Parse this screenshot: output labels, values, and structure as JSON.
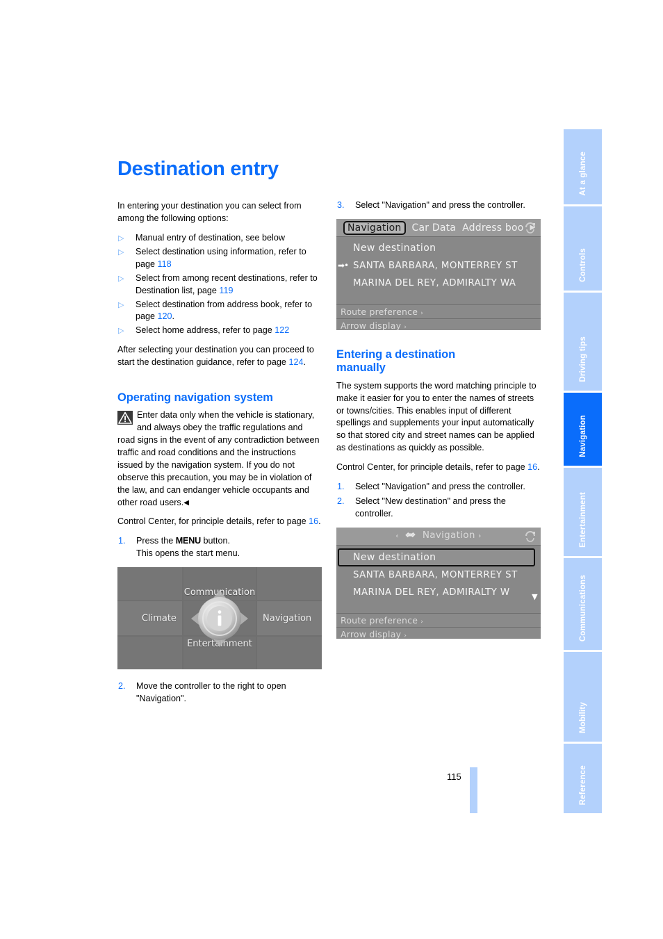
{
  "page": {
    "number": "115",
    "title": "Destination entry"
  },
  "sidebar": {
    "tabs": [
      {
        "label": "At a glance",
        "active": false
      },
      {
        "label": "Controls",
        "active": false
      },
      {
        "label": "Driving tips",
        "active": false
      },
      {
        "label": "Navigation",
        "active": true
      },
      {
        "label": "Entertainment",
        "active": false
      },
      {
        "label": "Communications",
        "active": false
      },
      {
        "label": "Mobility",
        "active": false
      },
      {
        "label": "Reference",
        "active": false
      }
    ],
    "active_color": "#0a6dfb",
    "inactive_color": "#b3d1fc"
  },
  "left_column": {
    "intro": "In entering your destination you can select from among the following options:",
    "options": [
      {
        "text": "Manual entry of destination, see below",
        "page": ""
      },
      {
        "text": "Select destination using information, refer to page ",
        "page": "118",
        "tail": ""
      },
      {
        "text": "Select from among recent destinations, refer to Destination list, page ",
        "page": "119",
        "tail": ""
      },
      {
        "text": "Select destination from address book, refer to page ",
        "page": "120",
        "tail": "."
      },
      {
        "text": "Select home address, refer to page ",
        "page": "122",
        "tail": ""
      }
    ],
    "after_paragraph_pre": "After selecting your destination you can proceed to start the destination guidance, refer to page ",
    "after_paragraph_page": "124",
    "after_paragraph_post": ".",
    "section_title": "Operating navigation system",
    "warning_text": "Enter data only when the vehicle is stationary, and always obey the traffic regulations and road signs in the event of any contradiction between traffic and road conditions and the instructions issued by the navigation system. If you do not observe this precaution, you may be in violation of the law, and can endanger vehicle occupants and other road users.",
    "warning_endmark": "◀",
    "control_center_pre": "Control Center, for principle details, refer to page ",
    "control_center_page": "16",
    "control_center_post": ".",
    "step1_pre": "Press the ",
    "step1_kw": "MENU",
    "step1_post": " button.",
    "step1_line2": "This opens the start menu.",
    "step1_num": "1.",
    "step2_num": "2.",
    "step2_text": "Move the controller to the right to open \"Navigation\"."
  },
  "right_column": {
    "step3_num": "3.",
    "step3_text": "Select \"Navigation\" and press the controller.",
    "section_title_line1": "Entering a destination",
    "section_title_line2": "manually",
    "paragraph": "The system supports the word matching principle to make it easier for you to enter the names of streets or towns/cities. This enables input of different spellings and supplements your input automatically so that stored city and street names can be applied as destinations as quickly as possible.",
    "control_center_pre": "Control Center, for principle details, refer to page ",
    "control_center_page": "16",
    "control_center_post": ".",
    "step1_num": "1.",
    "step1_text": "Select \"Navigation\" and press the controller.",
    "step2_num": "2.",
    "step2_text": "Select \"New destination\" and press the controller."
  },
  "start_menu_screenshot": {
    "name": "idrive-start-menu",
    "communication": "Communication",
    "climate": "Climate",
    "navigation": "Navigation",
    "entertainment": "Entertainment",
    "center_icon": "info-icon"
  },
  "nav_screenshot_1": {
    "name": "idrive-navigation-menu-tabbar",
    "tabs": [
      "Navigation",
      "Car Data",
      "Address boo"
    ],
    "selected_tab": "Navigation",
    "tab_more_arrow": "▶",
    "rows": [
      {
        "text": "New destination",
        "marker": "",
        "boxed": false
      },
      {
        "text": "SANTA BARBARA, MONTERREY ST",
        "marker": "➡•",
        "boxed": false
      },
      {
        "text": "MARINA DEL REY, ADMIRALTY WA",
        "marker": "",
        "boxed": false
      }
    ],
    "footer_rows": [
      "Route preference",
      "Arrow display"
    ],
    "footer_chevron": "›"
  },
  "nav_screenshot_2": {
    "name": "idrive-navigation-menu-centered",
    "title": "Navigation",
    "title_icon": "satellite-icon",
    "left_arrow": "‹",
    "right_arrow": "›",
    "rows": [
      {
        "text": "New destination",
        "boxed": true
      },
      {
        "text": "SANTA BARBARA, MONTERREY ST",
        "boxed": false
      },
      {
        "text": "MARINA DEL REY, ADMIRALTY W",
        "boxed": false
      }
    ],
    "scroll_indicator": "▼",
    "footer_rows": [
      "Route preference",
      "Arrow display"
    ],
    "footer_chevron": "›"
  }
}
